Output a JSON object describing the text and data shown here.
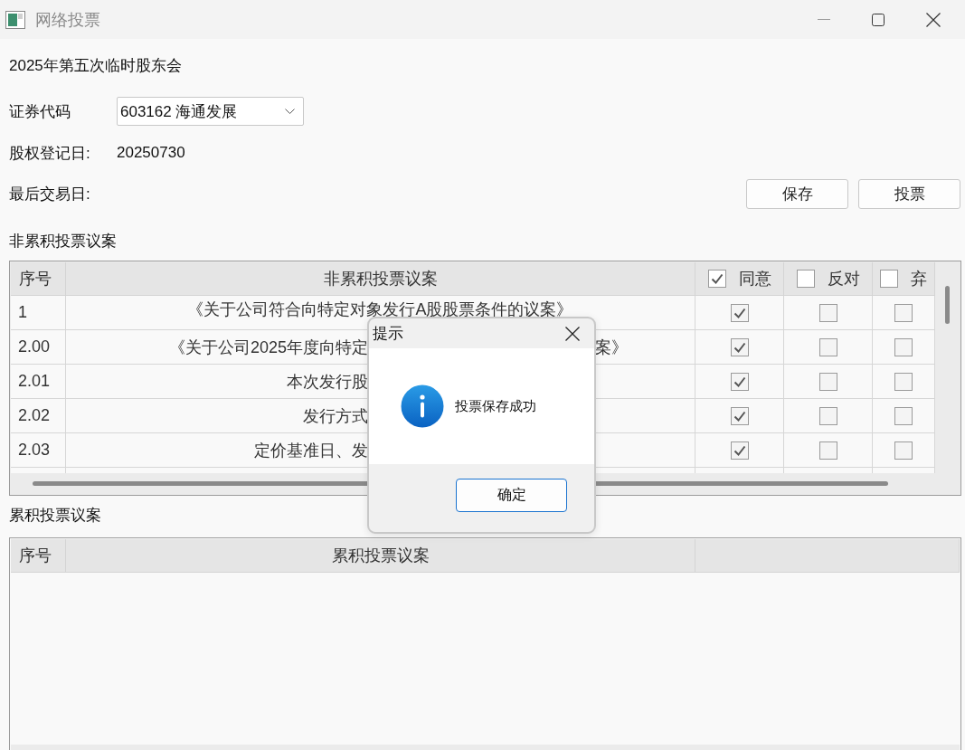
{
  "window": {
    "title": "网络投票"
  },
  "meeting": "2025年第五次临时股东会",
  "fields": [
    {
      "label": "证券代码",
      "kind": "dropdown",
      "value": "603162 海通发展"
    },
    {
      "label": "股权登记日:",
      "kind": "text",
      "value": "20250730"
    },
    {
      "label": "最后交易日:",
      "kind": "text"
    }
  ],
  "buttons": [
    "保存",
    "投票"
  ],
  "non_cumulative": {
    "title": "非累积投票议案",
    "columns": [
      {
        "label": "序号",
        "kind": "text"
      },
      {
        "label": "非累积投票议案",
        "kind": "text"
      },
      {
        "label": "同意",
        "kind": "check",
        "checked": true
      },
      {
        "label": "反对",
        "kind": "check",
        "checked": false
      },
      {
        "label": "弃",
        "kind": "check",
        "checked": false
      }
    ],
    "rows": [
      {
        "seq": "1",
        "kind": "whole",
        "title": "《关于公司符合向特定对象发行A股股票条件的议案》",
        "votes": [
          {
            "checked": true
          },
          {
            "checked": false
          },
          {
            "checked": false
          }
        ]
      },
      {
        "seq": "2.00",
        "kind": "covered",
        "title": "《关于公司2025年度向特定",
        "title_tail": "案》",
        "votes": [
          {
            "checked": true
          },
          {
            "checked": false
          },
          {
            "checked": false
          }
        ]
      },
      {
        "seq": "2.01",
        "kind": "covered",
        "title": "本次发行股",
        "votes": [
          {
            "checked": true
          },
          {
            "checked": false
          },
          {
            "checked": false
          }
        ]
      },
      {
        "seq": "2.02",
        "kind": "covered",
        "title": "发行方式",
        "votes": [
          {
            "checked": true
          },
          {
            "checked": false
          },
          {
            "checked": false
          }
        ]
      },
      {
        "seq": "2.03",
        "kind": "covered",
        "title": "定价基准日、发",
        "votes": [
          {
            "checked": true
          },
          {
            "checked": false
          },
          {
            "checked": false
          }
        ]
      }
    ]
  },
  "cumulative": {
    "title": "累积投票议案",
    "columns": [
      {
        "label": "序号"
      },
      {
        "label": "累积投票议案"
      }
    ]
  },
  "dialog": {
    "title": "提示",
    "message": "投票保存成功",
    "button": "确定"
  }
}
